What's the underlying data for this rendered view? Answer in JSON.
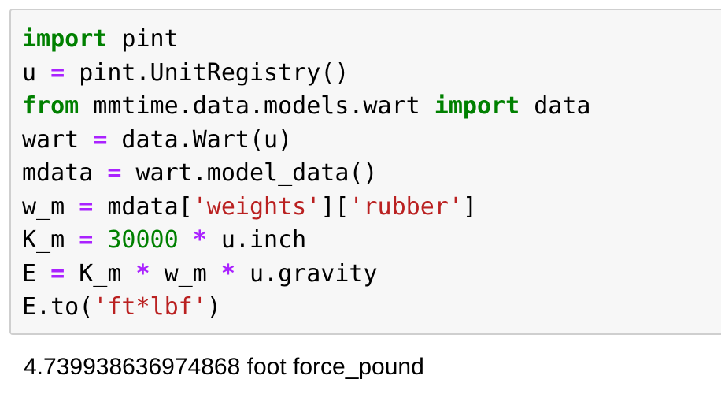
{
  "cell": {
    "lines": [
      {
        "tokens": [
          {
            "t": "import",
            "c": "kw"
          },
          {
            "t": " pint",
            "c": ""
          }
        ]
      },
      {
        "tokens": [
          {
            "t": "u ",
            "c": ""
          },
          {
            "t": "=",
            "c": "op"
          },
          {
            "t": " pint.UnitRegistry()",
            "c": ""
          }
        ]
      },
      {
        "tokens": [
          {
            "t": "from",
            "c": "kw"
          },
          {
            "t": " mmtime.data.models.wart ",
            "c": ""
          },
          {
            "t": "import",
            "c": "kw"
          },
          {
            "t": " data",
            "c": ""
          }
        ]
      },
      {
        "tokens": [
          {
            "t": "wart ",
            "c": ""
          },
          {
            "t": "=",
            "c": "op"
          },
          {
            "t": " data.Wart(u)",
            "c": ""
          }
        ]
      },
      {
        "tokens": [
          {
            "t": "mdata ",
            "c": ""
          },
          {
            "t": "=",
            "c": "op"
          },
          {
            "t": " wart.model_data()",
            "c": ""
          }
        ]
      },
      {
        "tokens": [
          {
            "t": "w_m ",
            "c": ""
          },
          {
            "t": "=",
            "c": "op"
          },
          {
            "t": " mdata[",
            "c": ""
          },
          {
            "t": "'weights'",
            "c": "str"
          },
          {
            "t": "][",
            "c": ""
          },
          {
            "t": "'rubber'",
            "c": "str"
          },
          {
            "t": "]",
            "c": ""
          }
        ]
      },
      {
        "tokens": [
          {
            "t": "K_m ",
            "c": ""
          },
          {
            "t": "=",
            "c": "op"
          },
          {
            "t": " ",
            "c": ""
          },
          {
            "t": "30000",
            "c": "num"
          },
          {
            "t": " ",
            "c": ""
          },
          {
            "t": "*",
            "c": "op"
          },
          {
            "t": " u.inch",
            "c": ""
          }
        ]
      },
      {
        "tokens": [
          {
            "t": "E ",
            "c": ""
          },
          {
            "t": "=",
            "c": "op"
          },
          {
            "t": " K_m ",
            "c": ""
          },
          {
            "t": "*",
            "c": "op"
          },
          {
            "t": " w_m ",
            "c": ""
          },
          {
            "t": "*",
            "c": "op"
          },
          {
            "t": " u.gravity",
            "c": ""
          }
        ]
      },
      {
        "tokens": [
          {
            "t": "E.to(",
            "c": ""
          },
          {
            "t": "'ft*lbf'",
            "c": "str"
          },
          {
            "t": ")",
            "c": ""
          }
        ]
      }
    ]
  },
  "output": {
    "text": "4.739938636974868 foot force_pound"
  },
  "colors": {
    "keyword": "#008000",
    "operator": "#aa22ff",
    "number": "#008000",
    "string": "#ba2121",
    "cell_background": "#f7f7f7",
    "cell_border": "#cfcfcf"
  }
}
